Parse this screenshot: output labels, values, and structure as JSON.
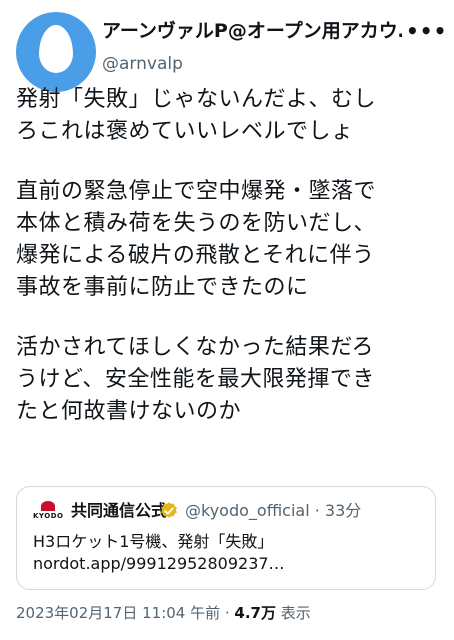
{
  "author": {
    "display_name": "アーンヴァルP@オープン用アカウ…",
    "handle": "@arnvalp",
    "avatar_icon": "default-egg-avatar",
    "avatar_color": "#4a9ee8"
  },
  "more_icon": "ellipsis-icon",
  "tweet": {
    "paragraphs": [
      {
        "lines": [
          "発射「失敗」じゃないんだよ、むし",
          "ろこれは褒めていいレベルでしょ"
        ]
      },
      {
        "lines": [
          "直前の緊急停止で空中爆発・墜落で",
          "本体と積み荷を失うのを防いだし、",
          "爆発による破片の飛散とそれに伴う",
          "事故を事前に防止できたのに"
        ]
      },
      {
        "lines": [
          "活かされてほしくなかった結果だろ",
          "うけど、安全性能を最大限発揮でき",
          "たと何故書けないのか"
        ]
      }
    ]
  },
  "quoted": {
    "logo_icon": "kyodo-logo",
    "logo_text": "KYODO",
    "name": "共同通信公式",
    "verified_icon": "verified-gold-badge-icon",
    "handle_time": "@kyodo_official · 33分",
    "lines": [
      "H3ロケット1号機、発射「失敗」",
      "nordot.app/99912952809237…"
    ],
    "brand_color": "#c8102e"
  },
  "meta": {
    "timestamp": "2023年02月17日 11:04 午前 · ",
    "views_count": "4.7万",
    "views_label": " 表示"
  }
}
